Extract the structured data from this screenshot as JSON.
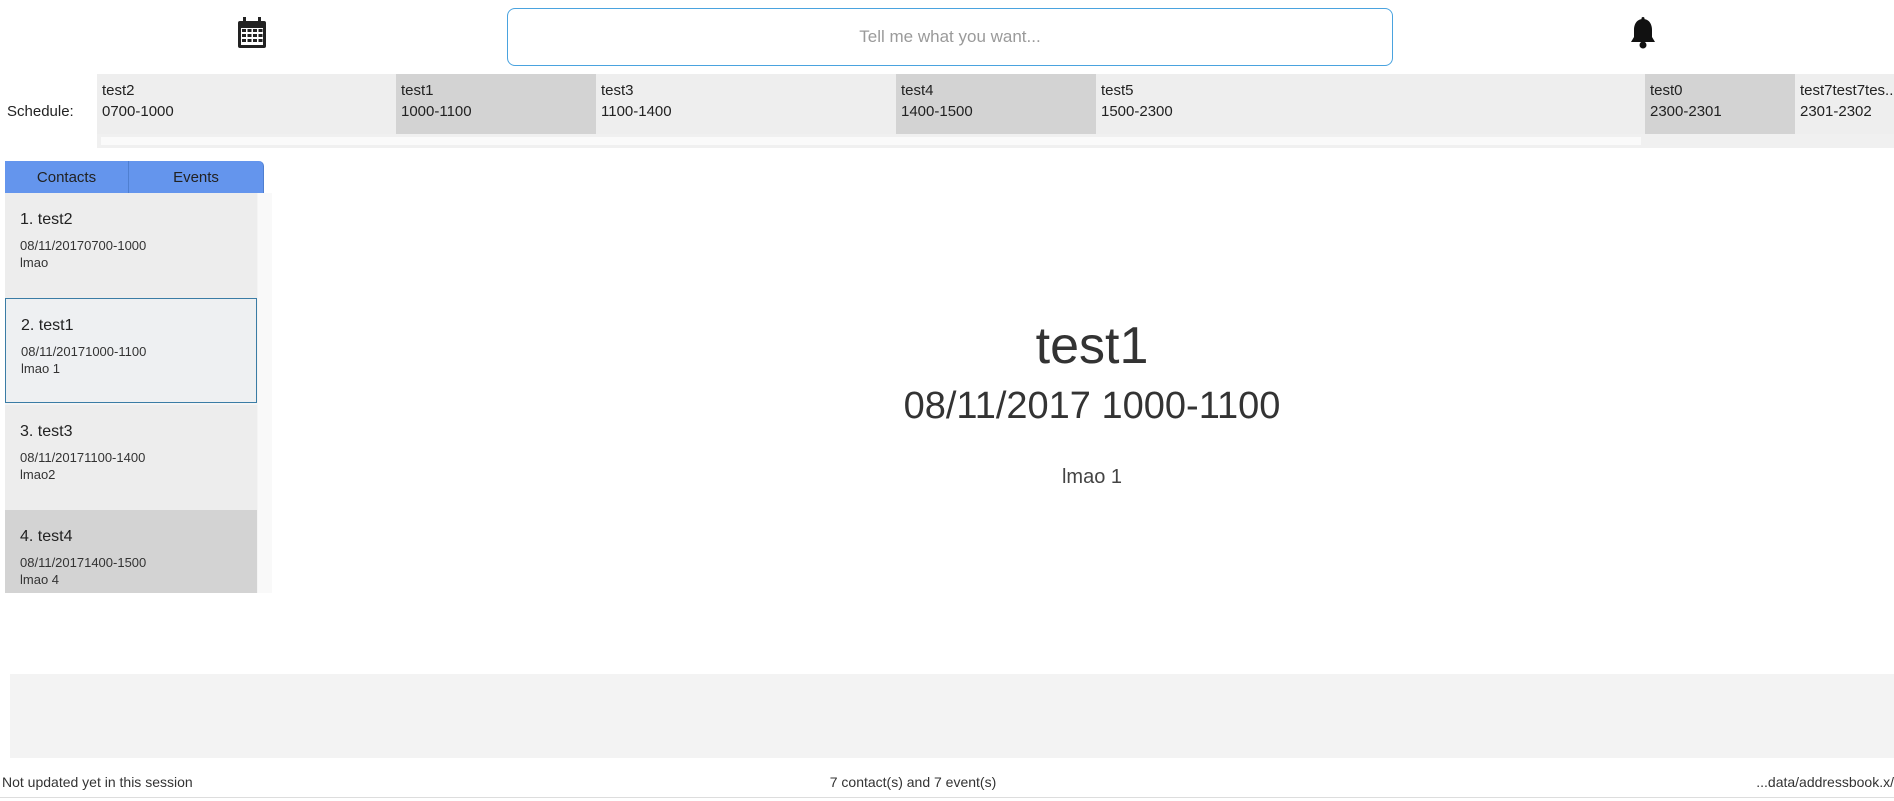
{
  "search": {
    "placeholder": "Tell me what you want..."
  },
  "icons": {
    "calendar": "calendar-icon",
    "notifications": "bell-icon"
  },
  "schedule": {
    "label": "Schedule:",
    "slots": [
      {
        "name": "test2",
        "time": "0700-1000"
      },
      {
        "name": "test1",
        "time": "1000-1100"
      },
      {
        "name": "test3",
        "time": "1100-1400"
      },
      {
        "name": "test4",
        "time": "1400-1500"
      },
      {
        "name": "test5",
        "time": "1500-2300"
      },
      {
        "name": "test0",
        "time": "2300-2301"
      },
      {
        "name": "test7test7tes...",
        "time": "2301-2302"
      }
    ]
  },
  "tabs": {
    "contacts": "Contacts",
    "events": "Events"
  },
  "events": [
    {
      "name": "1.  test2",
      "datetime": "08/11/20170700-1000",
      "address": "lmao"
    },
    {
      "name": "2.  test1",
      "datetime": "08/11/20171000-1100",
      "address": "lmao 1"
    },
    {
      "name": "3.  test3",
      "datetime": "08/11/20171100-1400",
      "address": "lmao2"
    },
    {
      "name": "4.  test4",
      "datetime": "08/11/20171400-1500",
      "address": "lmao 4"
    }
  ],
  "selected_event": {
    "name": "test1",
    "datetime": "08/11/2017 1000-1100",
    "address": "lmao 1"
  },
  "status": {
    "sync": "Not updated yet in this session",
    "counts": "7 contact(s) and 7 event(s)",
    "path": "...data/addressbook.x/"
  },
  "colors": {
    "tab_bg": "#6495ed",
    "slot_dark": "#d3d3d3",
    "slot_light": "#eeeeee",
    "search_border": "#4aa3df"
  }
}
